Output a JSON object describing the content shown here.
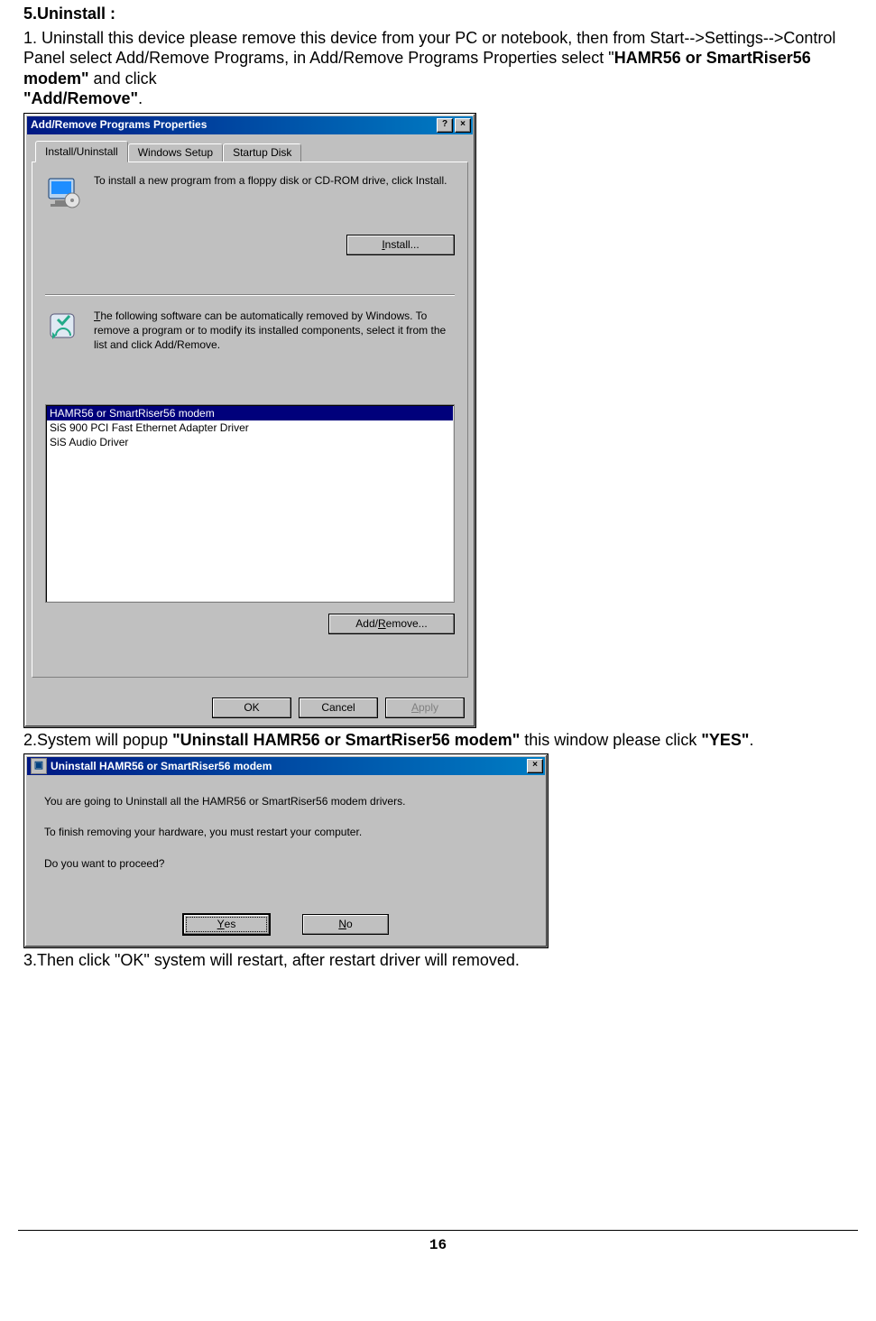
{
  "doc": {
    "heading": "5.Uninstall :",
    "step1_a": "1. Uninstall this device please remove this device from your PC or notebook, then from Start-->Settings-->Control Panel select Add/Remove Programs, in   Add/Remove Programs Properties select \"",
    "step1_bold1": "HAMR56 or SmartRiser56 modem\"",
    "step1_b": " and click ",
    "step1_bold2": "\"Add/Remove\"",
    "step1_c": ".",
    "step2_a": "2.",
    "step2_b": "System will popup ",
    "step2_bold": "\"Uninstall HAMR56 or SmartRiser56 modem\"",
    "step2_c": " this window please click ",
    "step2_bold2": "\"YES\"",
    "step2_d": ".",
    "step3": "3.Then click \"OK\" system will restart, after restart driver will removed.",
    "page_number": "16"
  },
  "dialog1": {
    "title": "Add/Remove Programs Properties",
    "help_btn": "?",
    "close_btn": "×",
    "tabs": [
      "Install/Uninstall",
      "Windows Setup",
      "Startup Disk"
    ],
    "active_tab": 0,
    "install_text": "To install a new program from a floppy disk or CD-ROM drive, click Install.",
    "install_btn_pre": "",
    "install_btn_u": "I",
    "install_btn_post": "nstall...",
    "remove_text_pre": "",
    "remove_text_u": "T",
    "remove_text_post": "he following software can be automatically removed by Windows. To remove a program or to modify its installed components, select it from the list and click Add/Remove.",
    "list": [
      "HAMR56 or SmartRiser56 modem",
      "SiS 900 PCI Fast Ethernet Adapter Driver",
      "SiS Audio Driver"
    ],
    "selected_index": 0,
    "addremove_btn_pre": "Add/",
    "addremove_btn_u": "R",
    "addremove_btn_post": "emove...",
    "ok": "OK",
    "cancel": "Cancel",
    "apply_pre": "",
    "apply_u": "A",
    "apply_post": "pply"
  },
  "dialog2": {
    "title": "Uninstall HAMR56 or SmartRiser56 modem",
    "close_btn": "×",
    "line1": "You are going to Uninstall all the HAMR56 or SmartRiser56 modem drivers.",
    "line2": "To finish removing your hardware, you must restart your computer.",
    "line3": "Do you want to proceed?",
    "yes_pre": "",
    "yes_u": "Y",
    "yes_post": "es",
    "no_pre": "",
    "no_u": "N",
    "no_post": "o"
  }
}
